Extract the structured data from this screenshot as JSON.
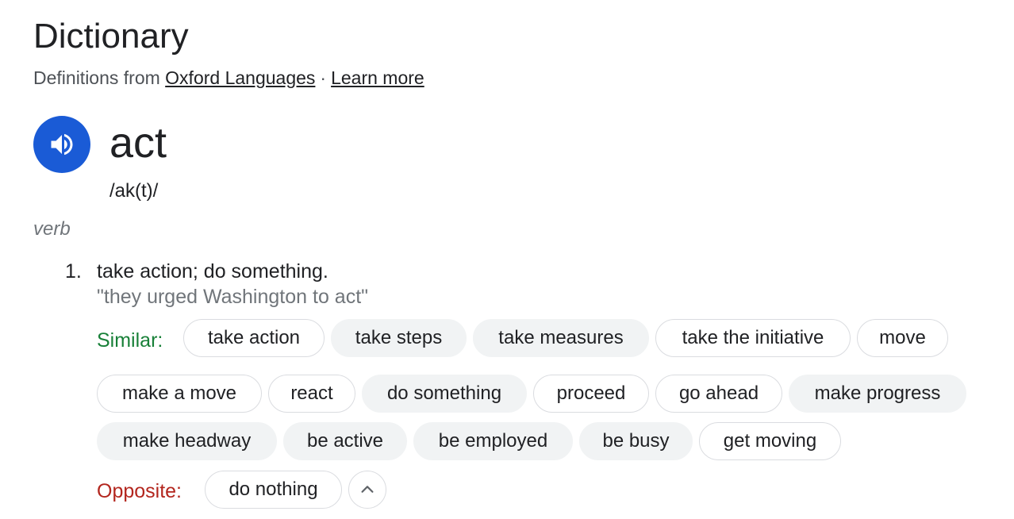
{
  "header": {
    "title": "Dictionary",
    "source_prefix": "Definitions from",
    "source_link": "Oxford Languages",
    "separator": "·",
    "learn_more": "Learn more"
  },
  "entry": {
    "word": "act",
    "phonetic": "/ak(t)/",
    "part_of_speech": "verb",
    "audio_icon": "speaker-icon",
    "accent_color": "#1a5bd6"
  },
  "sense": {
    "number": "1.",
    "definition": "take action; do something.",
    "example": "\"they urged Washington to act\""
  },
  "similar": {
    "label": "Similar:",
    "chips": [
      "take action",
      "take steps",
      "take measures",
      "take the initiative",
      "move",
      "make a move",
      "react",
      "do something",
      "proceed",
      "go ahead",
      "make progress",
      "make headway",
      "be active",
      "be employed",
      "be busy",
      "get moving"
    ]
  },
  "opposite": {
    "label": "Opposite:",
    "chips": [
      "do nothing"
    ],
    "collapse_icon": "chevron-up-icon"
  },
  "colors": {
    "similar_label": "#188038",
    "opposite_label": "#b3261e",
    "chip_fill": "#f1f3f4",
    "chip_border": "#dadce0"
  }
}
